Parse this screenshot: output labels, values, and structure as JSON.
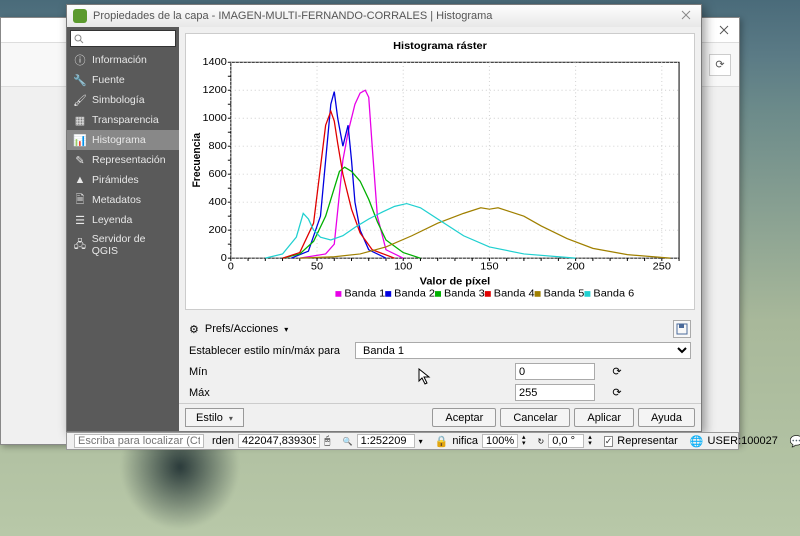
{
  "window_title": "Propiedades de la capa - IMAGEN-MULTI-FERNANDO-CORRALES | Histograma",
  "sidebar": {
    "items": [
      {
        "label": "Información",
        "icon": "info-icon"
      },
      {
        "label": "Fuente",
        "icon": "wrench-icon"
      },
      {
        "label": "Simbología",
        "icon": "brush-icon"
      },
      {
        "label": "Transparencia",
        "icon": "checker-icon"
      },
      {
        "label": "Histograma",
        "icon": "histogram-icon"
      },
      {
        "label": "Representación",
        "icon": "pencil-icon"
      },
      {
        "label": "Pirámides",
        "icon": "pyramid-icon"
      },
      {
        "label": "Metadatos",
        "icon": "metadata-icon"
      },
      {
        "label": "Leyenda",
        "icon": "legend-icon"
      },
      {
        "label": "Servidor de QGIS",
        "icon": "server-icon"
      }
    ]
  },
  "chart_data": {
    "type": "line",
    "title": "Histograma ráster",
    "xlabel": "Valor de píxel",
    "ylabel": "Frecuencia",
    "xlim": [
      0,
      260
    ],
    "ylim": [
      0,
      1400
    ],
    "xticks": [
      0,
      50,
      100,
      150,
      200,
      250
    ],
    "yticks": [
      0,
      200,
      400,
      600,
      800,
      1000,
      1200,
      1400
    ],
    "series": [
      {
        "name": "Banda 1",
        "color": "#e800e8",
        "x": [
          40,
          55,
          60,
          65,
          68,
          72,
          75,
          78,
          80,
          82,
          85,
          90,
          100
        ],
        "y": [
          0,
          30,
          100,
          700,
          900,
          1100,
          1180,
          1200,
          1150,
          800,
          300,
          60,
          0
        ]
      },
      {
        "name": "Banda 2",
        "color": "#0000e0",
        "x": [
          35,
          45,
          52,
          55,
          58,
          60,
          62,
          65,
          68,
          70,
          72,
          75,
          80,
          90
        ],
        "y": [
          0,
          50,
          300,
          700,
          1100,
          1190,
          1000,
          800,
          950,
          700,
          400,
          200,
          60,
          0
        ]
      },
      {
        "name": "Banda 3",
        "color": "#00b000",
        "x": [
          30,
          40,
          48,
          55,
          60,
          63,
          66,
          70,
          75,
          80,
          85,
          90,
          100,
          110
        ],
        "y": [
          0,
          30,
          120,
          300,
          500,
          620,
          650,
          620,
          550,
          420,
          260,
          130,
          40,
          0
        ]
      },
      {
        "name": "Banda 4",
        "color": "#e00000",
        "x": [
          30,
          40,
          48,
          52,
          55,
          58,
          60,
          62,
          65,
          70,
          75,
          82,
          95
        ],
        "y": [
          0,
          40,
          250,
          650,
          950,
          1050,
          980,
          820,
          600,
          350,
          180,
          60,
          0
        ]
      },
      {
        "name": "Banda 5",
        "color": "#a08000",
        "x": [
          40,
          60,
          75,
          90,
          105,
          120,
          135,
          145,
          150,
          155,
          160,
          170,
          180,
          195,
          210,
          230,
          255
        ],
        "y": [
          0,
          10,
          30,
          80,
          160,
          250,
          320,
          360,
          350,
          360,
          340,
          300,
          230,
          140,
          70,
          25,
          0
        ]
      },
      {
        "name": "Banda 6",
        "color": "#20d0d0",
        "x": [
          20,
          30,
          38,
          42,
          45,
          48,
          52,
          58,
          65,
          72,
          80,
          88,
          95,
          102,
          110,
          120,
          135,
          150,
          170,
          200
        ],
        "y": [
          0,
          30,
          150,
          320,
          280,
          200,
          150,
          130,
          160,
          220,
          280,
          330,
          370,
          390,
          360,
          280,
          160,
          80,
          30,
          0
        ]
      }
    ]
  },
  "prefs_label": "Prefs/Acciones",
  "style_label": "Establecer estilo mín/máx para",
  "band_selected": "Banda 1",
  "min_label": "Mín",
  "min_value": "0",
  "max_label": "Máx",
  "max_value": "255",
  "btn_style": "Estilo",
  "btn_accept": "Aceptar",
  "btn_cancel": "Cancelar",
  "btn_apply": "Aplicar",
  "btn_help": "Ayuda",
  "status": {
    "locator_placeholder": "Escriba para localizar (Ctrl+K)",
    "coord_label": "rden",
    "coord": "422047,839305",
    "scale_label": "",
    "scale": "1:252209",
    "mag_label": "nifica",
    "mag": "100%",
    "rot": "0,0 °",
    "render": "Representar",
    "user": "USER:100027"
  }
}
